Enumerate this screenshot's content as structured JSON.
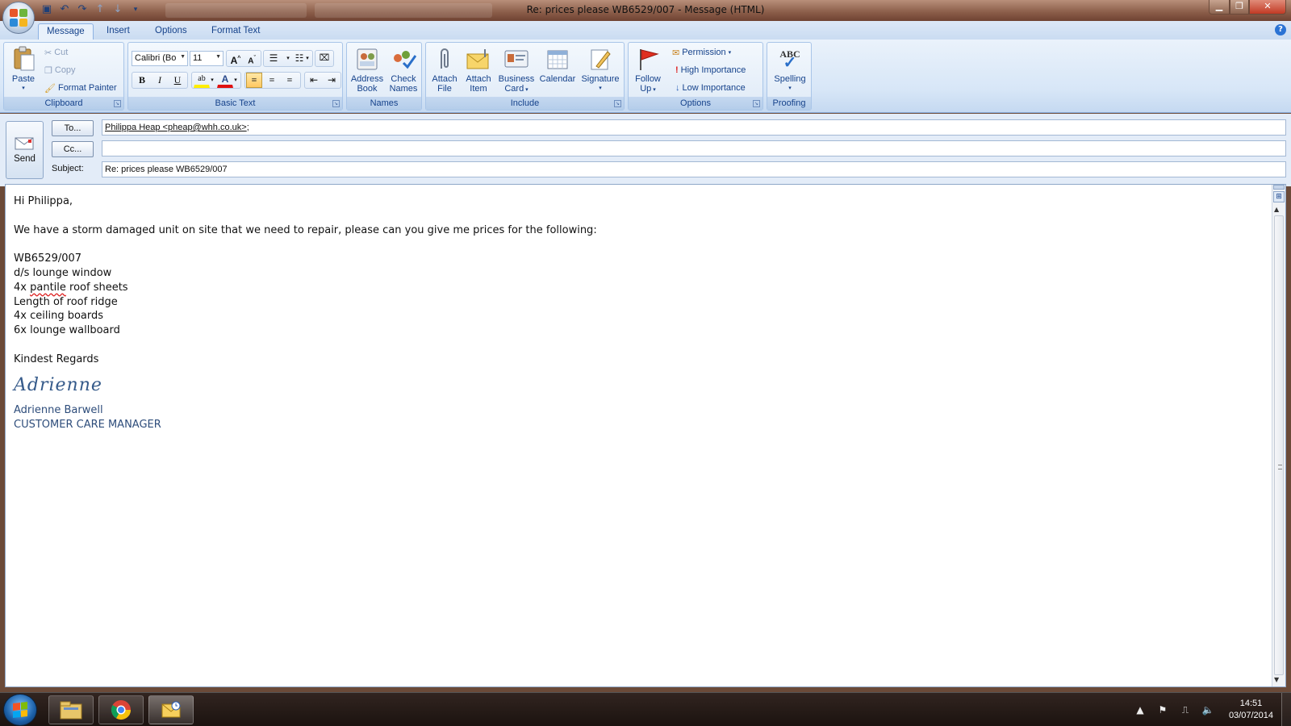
{
  "window": {
    "title": "Re: prices please WB6529/007 - Message (HTML)",
    "controls": {
      "minimize": "▁",
      "maximize": "❐",
      "close": "✕"
    }
  },
  "ribbon_tabs": [
    "Message",
    "Insert",
    "Options",
    "Format Text"
  ],
  "active_tab": "Message",
  "groups": {
    "clipboard": {
      "label": "Clipboard",
      "paste": "Paste",
      "cut": "Cut",
      "copy": "Copy",
      "format_painter": "Format Painter"
    },
    "basic_text": {
      "label": "Basic Text",
      "font_name": "Calibri (Bo",
      "font_size": "11"
    },
    "names": {
      "label": "Names",
      "address_book_l1": "Address",
      "address_book_l2": "Book",
      "check_names_l1": "Check",
      "check_names_l2": "Names"
    },
    "include": {
      "label": "Include",
      "attach_file_l1": "Attach",
      "attach_file_l2": "File",
      "attach_item_l1": "Attach",
      "attach_item_l2": "Item",
      "business_card_l1": "Business",
      "business_card_l2": "Card",
      "calendar": "Calendar",
      "signature": "Signature"
    },
    "options": {
      "label": "Options",
      "follow_up_l1": "Follow",
      "follow_up_l2": "Up",
      "permission": "Permission",
      "high_importance": "High Importance",
      "low_importance": "Low Importance"
    },
    "proofing": {
      "label": "Proofing",
      "spelling": "Spelling",
      "abc": "ABC"
    }
  },
  "message": {
    "send_label": "Send",
    "to_label": "To...",
    "cc_label": "Cc...",
    "subject_label": "Subject:",
    "to_value": "Philippa Heap <pheap@whh.co.uk>",
    "to_suffix": ";",
    "cc_value": "",
    "subject_value": "Re: prices please WB6529/007"
  },
  "body": {
    "greeting": "Hi Philippa,",
    "intro": "We have a storm damaged unit on site that we need to repair, please can you give me prices for the following:",
    "reference": "WB6529/007",
    "items": [
      "d/s lounge window",
      "4x pantile roof sheets",
      "Length of roof ridge",
      "4x ceiling boards",
      "6x lounge wallboard"
    ],
    "closing": "Kindest Regards",
    "signature_script": "Adrienne",
    "signature_name": "Adrienne Barwell",
    "signature_title": "CUSTOMER CARE MANAGER"
  },
  "taskbar": {
    "time": "14:51",
    "date": "03/07/2014"
  },
  "colors": {
    "ribbon_text": "#15428b",
    "ribbon_bg": "#dce8f7",
    "signature": "#2e4d7b",
    "selected_button": "#ffc862"
  }
}
